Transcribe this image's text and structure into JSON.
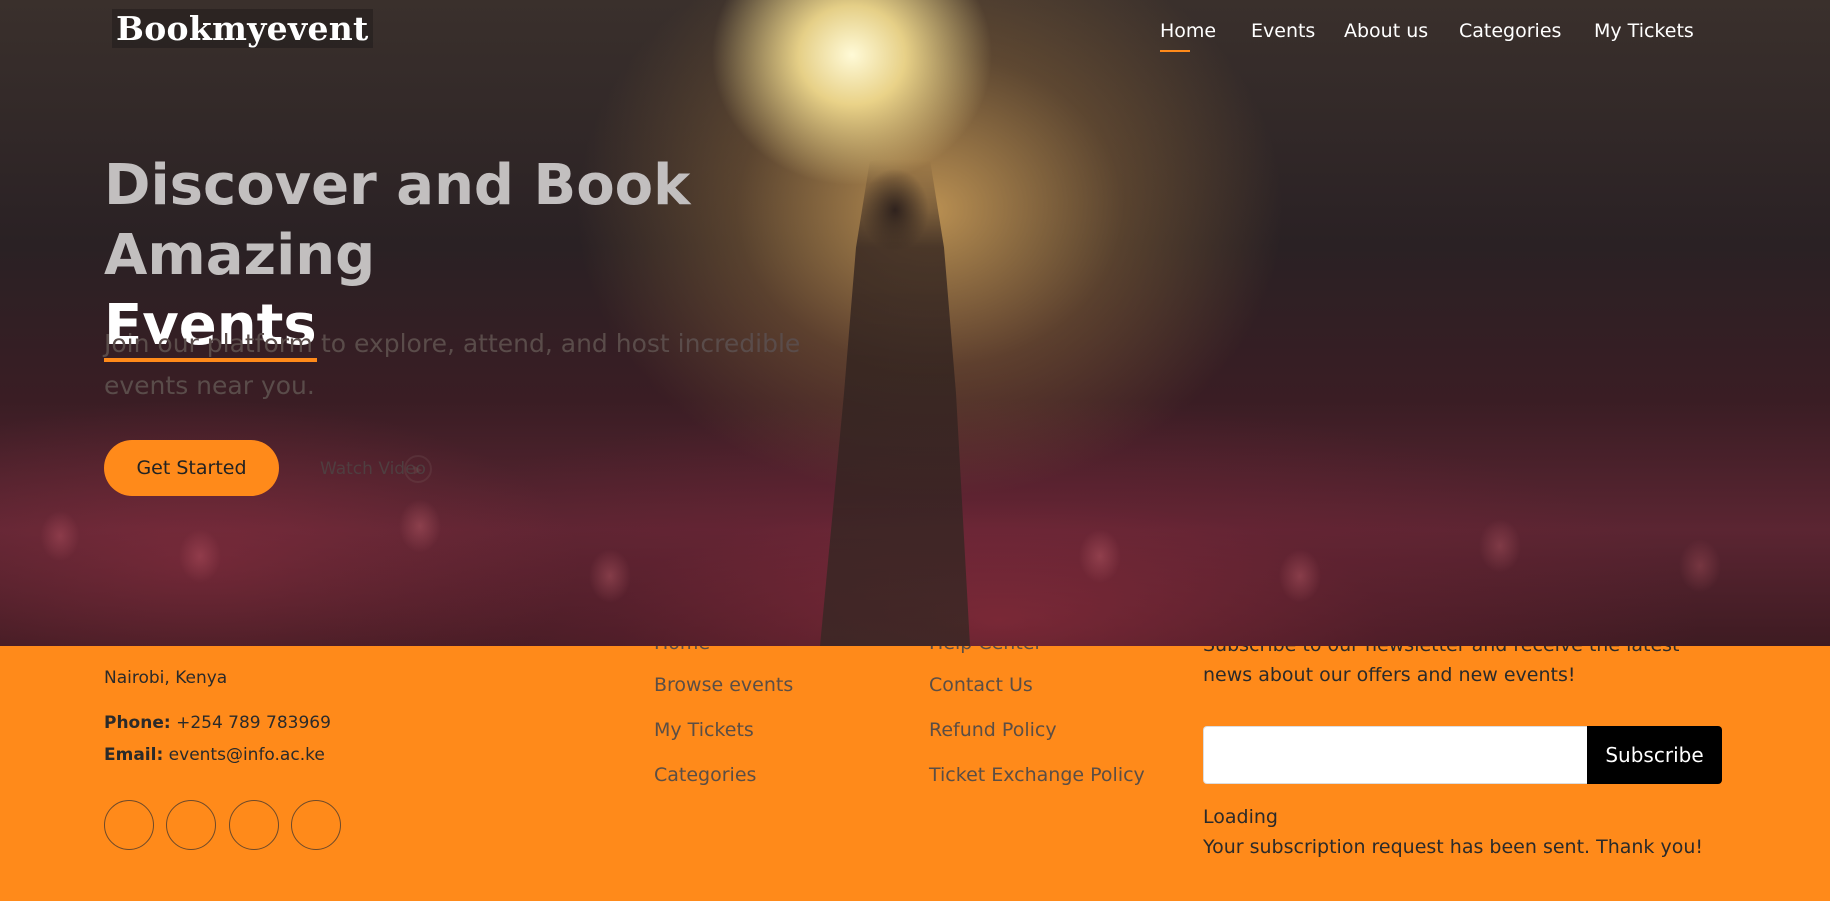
{
  "brand": {
    "name": "Bookmyevent"
  },
  "nav": {
    "items": [
      {
        "label": "Home",
        "active": true
      },
      {
        "label": "Events"
      },
      {
        "label": "About us"
      },
      {
        "label": "Categories"
      },
      {
        "label": "My Tickets"
      }
    ]
  },
  "hero": {
    "title_line1": "Discover and Book Amazing",
    "title_line2": "Events",
    "subtitle": "Join our platform to explore, attend, and host incredible events near you.",
    "cta_label": "Get Started",
    "watch_label": "Watch Video",
    "watch_icon": "play-icon"
  },
  "footer": {
    "contact": {
      "address": "Nairobi, Kenya",
      "phone_label": "Phone:",
      "phone": "+254 789 783969",
      "email_label": "Email:",
      "email": "events@info.ac.ke"
    },
    "social_icons": [
      "twitter-icon",
      "facebook-icon",
      "instagram-icon",
      "linkedin-icon"
    ],
    "links_col1": {
      "clipped": "Home",
      "items": [
        "Browse events",
        "My Tickets",
        "Categories"
      ]
    },
    "links_col2": {
      "clipped": "Help Center",
      "items": [
        "Contact Us",
        "Refund Policy",
        "Ticket Exchange Policy"
      ]
    },
    "newsletter": {
      "text": "Subscribe to our newsletter and receive the latest news about our offers and new events!",
      "input_value": "",
      "button_label": "Subscribe",
      "loading": "Loading",
      "sent_message": "Your subscription request has been sent. Thank you!"
    }
  },
  "colors": {
    "accent": "#ff8a1a",
    "button_dark": "#000000",
    "text_light": "#ffffff"
  }
}
